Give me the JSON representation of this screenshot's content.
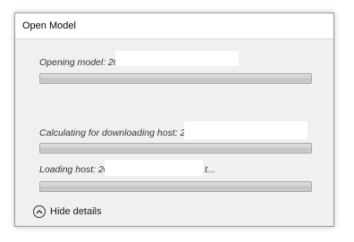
{
  "window": {
    "title": "Open Model"
  },
  "steps": [
    {
      "label": "Opening model: 20",
      "progress": 1.0
    },
    {
      "label": "Calculating for downloading host: 2",
      "progress": 1.0
    },
    {
      "label": "Loading host: 20",
      "suffix": "t...",
      "progress": 1.0
    }
  ],
  "details_toggle": {
    "label": "Hide details",
    "icon": "chevron-up-circle-icon"
  },
  "colors": {
    "dialog_bg": "#f0f0f0",
    "titlebar_bg": "#ffffff",
    "bar_fill": "#cfcfcf"
  }
}
